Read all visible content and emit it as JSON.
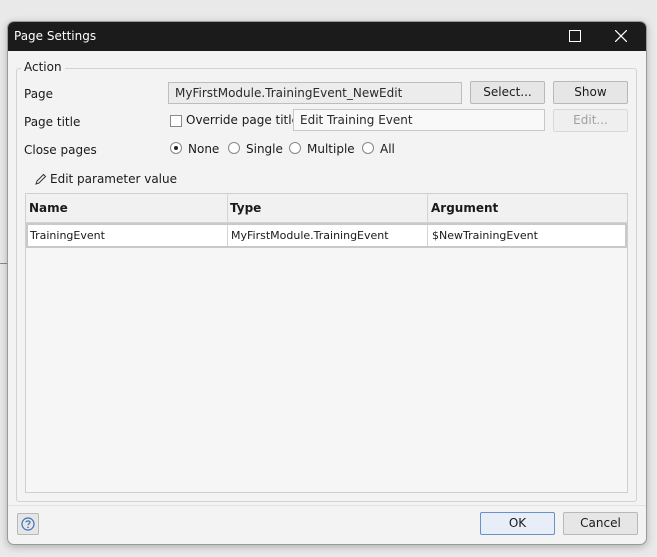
{
  "window": {
    "title": "Page Settings"
  },
  "group": {
    "legend": "Action"
  },
  "page": {
    "label": "Page",
    "value": "MyFirstModule.TrainingEvent_NewEdit",
    "select_label": "Select...",
    "show_label": "Show"
  },
  "page_title": {
    "label": "Page title",
    "override_label": "Override page title",
    "override_checked": false,
    "value": "Edit Training Event",
    "edit_label": "Edit..."
  },
  "close_pages": {
    "label": "Close pages",
    "options": [
      "None",
      "Single",
      "Multiple",
      "All"
    ],
    "selected": "None"
  },
  "edit_param_label": "Edit parameter value",
  "table": {
    "columns": [
      "Name",
      "Type",
      "Argument"
    ],
    "rows": [
      [
        "TrainingEvent",
        "MyFirstModule.TrainingEvent",
        "$NewTrainingEvent"
      ]
    ]
  },
  "footer": {
    "ok_label": "OK",
    "cancel_label": "Cancel"
  },
  "colors": {
    "titlebar": "#1b1b1b",
    "dialog_bg": "#f3f3f3",
    "primary_border": "#6b8fc7"
  }
}
